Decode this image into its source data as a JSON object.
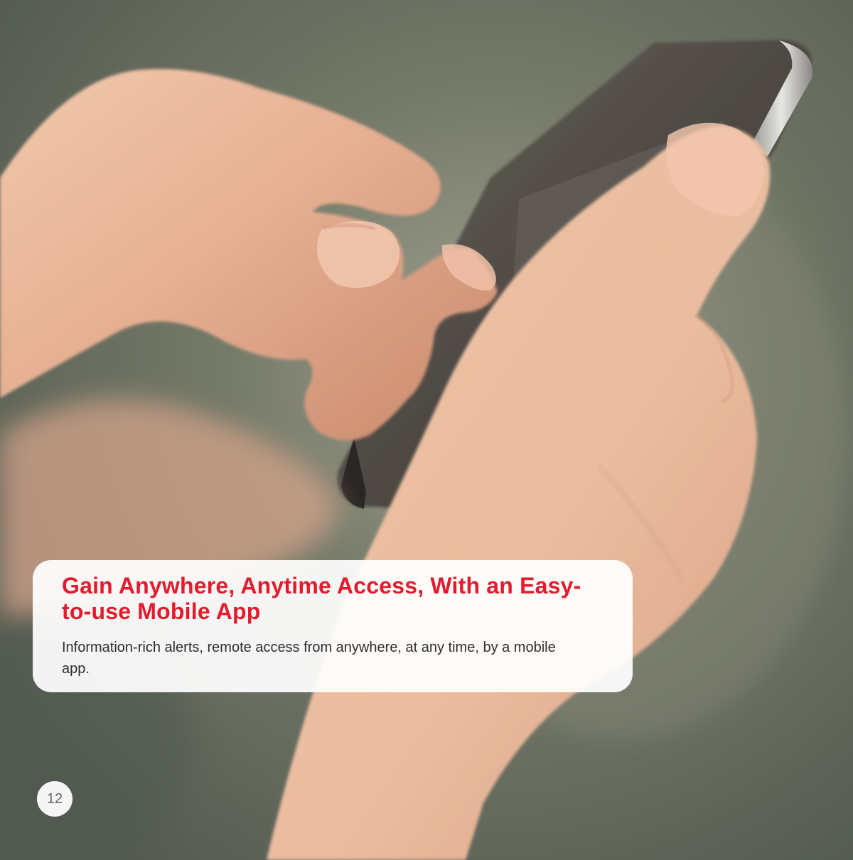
{
  "caption": {
    "title": "Gain Anywhere, Anytime Access, With an Easy-to-use Mobile App",
    "body": "Information-rich alerts, remote access from anywhere, at any time, by a mobile app."
  },
  "page_number": "12",
  "colors": {
    "title_red": "#e31b2d",
    "body_text": "#2d2d2d",
    "card_background": "#ffffff",
    "skin_tone": "#e8b79b",
    "phone_body": "#3f3934",
    "background": "#6f7567"
  },
  "photo": {
    "subject": "hands-holding-smartphone"
  }
}
